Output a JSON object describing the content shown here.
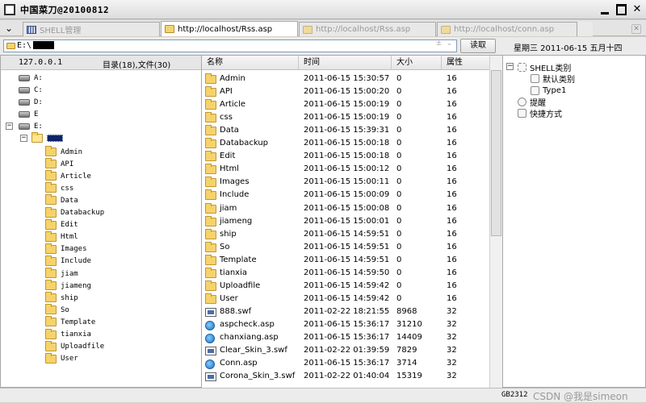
{
  "window": {
    "title": "中国菜刀@20100812"
  },
  "tabs": [
    {
      "label": "SHELL管理",
      "icon": "grid-icon",
      "active": false
    },
    {
      "label": "http://localhost/Rss.asp",
      "icon": "folder-icon",
      "active": true
    },
    {
      "label": "http://localhost/Rss.asp",
      "icon": "folder-icon",
      "active": false
    },
    {
      "label": "http://localhost/conn.asp",
      "icon": "folder-icon",
      "active": false
    }
  ],
  "address": {
    "path": "E:\\",
    "read_label": "读取",
    "datetime": "星期三 2011-06-15 五月十四"
  },
  "left_panel": {
    "ip": "127.0.0.1",
    "counts": "目录(18),文件(30)",
    "drives": [
      "A:",
      "C:",
      "D:",
      "E",
      "E:"
    ],
    "folders": [
      "Admin",
      "API",
      "Article",
      "css",
      "Data",
      "Databackup",
      "Edit",
      "Html",
      "Images",
      "Include",
      "jiam",
      "jiameng",
      "ship",
      "So",
      "Template",
      "tianxia",
      "Uploadfile",
      "User"
    ]
  },
  "file_table": {
    "headers": {
      "name": "名称",
      "time": "时间",
      "size": "大小",
      "attr": "属性"
    },
    "rows": [
      {
        "type": "folder",
        "name": "Admin",
        "time": "2011-06-15 15:30:57",
        "size": "0",
        "attr": "16"
      },
      {
        "type": "folder",
        "name": "API",
        "time": "2011-06-15 15:00:20",
        "size": "0",
        "attr": "16"
      },
      {
        "type": "folder",
        "name": "Article",
        "time": "2011-06-15 15:00:19",
        "size": "0",
        "attr": "16"
      },
      {
        "type": "folder",
        "name": "css",
        "time": "2011-06-15 15:00:19",
        "size": "0",
        "attr": "16"
      },
      {
        "type": "folder",
        "name": "Data",
        "time": "2011-06-15 15:39:31",
        "size": "0",
        "attr": "16"
      },
      {
        "type": "folder",
        "name": "Databackup",
        "time": "2011-06-15 15:00:18",
        "size": "0",
        "attr": "16"
      },
      {
        "type": "folder",
        "name": "Edit",
        "time": "2011-06-15 15:00:18",
        "size": "0",
        "attr": "16"
      },
      {
        "type": "folder",
        "name": "Html",
        "time": "2011-06-15 15:00:12",
        "size": "0",
        "attr": "16"
      },
      {
        "type": "folder",
        "name": "Images",
        "time": "2011-06-15 15:00:11",
        "size": "0",
        "attr": "16"
      },
      {
        "type": "folder",
        "name": "Include",
        "time": "2011-06-15 15:00:09",
        "size": "0",
        "attr": "16"
      },
      {
        "type": "folder",
        "name": "jiam",
        "time": "2011-06-15 15:00:08",
        "size": "0",
        "attr": "16"
      },
      {
        "type": "folder",
        "name": "jiameng",
        "time": "2011-06-15 15:00:01",
        "size": "0",
        "attr": "16"
      },
      {
        "type": "folder",
        "name": "ship",
        "time": "2011-06-15 14:59:51",
        "size": "0",
        "attr": "16"
      },
      {
        "type": "folder",
        "name": "So",
        "time": "2011-06-15 14:59:51",
        "size": "0",
        "attr": "16"
      },
      {
        "type": "folder",
        "name": "Template",
        "time": "2011-06-15 14:59:51",
        "size": "0",
        "attr": "16"
      },
      {
        "type": "folder",
        "name": "tianxia",
        "time": "2011-06-15 14:59:50",
        "size": "0",
        "attr": "16"
      },
      {
        "type": "folder",
        "name": "Uploadfile",
        "time": "2011-06-15 14:59:42",
        "size": "0",
        "attr": "16"
      },
      {
        "type": "folder",
        "name": "User",
        "time": "2011-06-15 14:59:42",
        "size": "0",
        "attr": "16"
      },
      {
        "type": "swf",
        "name": "888.swf",
        "time": "2011-02-22 18:21:55",
        "size": "8968",
        "attr": "32"
      },
      {
        "type": "asp",
        "name": "aspcheck.asp",
        "time": "2011-06-15 15:36:17",
        "size": "31210",
        "attr": "32"
      },
      {
        "type": "asp",
        "name": "chanxiang.asp",
        "time": "2011-06-15 15:36:17",
        "size": "14409",
        "attr": "32"
      },
      {
        "type": "swf",
        "name": "Clear_Skin_3.swf",
        "time": "2011-02-22 01:39:59",
        "size": "7829",
        "attr": "32"
      },
      {
        "type": "asp",
        "name": "Conn.asp",
        "time": "2011-06-15 15:36:17",
        "size": "3714",
        "attr": "32"
      },
      {
        "type": "swf",
        "name": "Corona_Skin_3.swf",
        "time": "2011-02-22 01:40:04",
        "size": "15319",
        "attr": "32"
      }
    ]
  },
  "right_panel": {
    "items": [
      {
        "label": "SHELL类别",
        "level": 0
      },
      {
        "label": "默认类别",
        "level": 1
      },
      {
        "label": "Type1",
        "level": 1
      },
      {
        "label": "提醒",
        "level": 0
      },
      {
        "label": "快捷方式",
        "level": 0
      }
    ]
  },
  "status": {
    "encoding": "GB2312",
    "watermark": "CSDN @我是simeon"
  }
}
